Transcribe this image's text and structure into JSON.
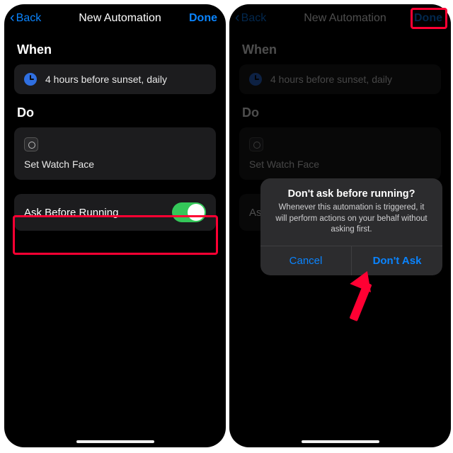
{
  "nav": {
    "back": "Back",
    "title": "New Automation",
    "done": "Done"
  },
  "sections": {
    "when": "When",
    "do": "Do"
  },
  "when_card": {
    "text": "4 hours before sunset, daily"
  },
  "do_card": {
    "text": "Set Watch Face"
  },
  "ask_row": {
    "label": "Ask Before Running"
  },
  "dialog": {
    "title": "Don't ask before running?",
    "message": "Whenever this automation is triggered, it will perform actions on your behalf without asking first.",
    "cancel": "Cancel",
    "confirm": "Don't Ask"
  }
}
